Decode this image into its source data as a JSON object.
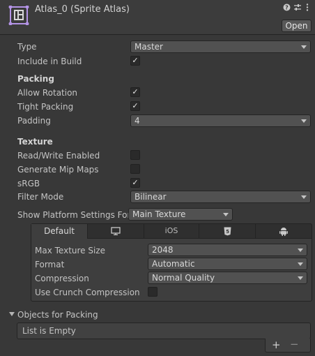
{
  "header": {
    "title": "Atlas_0 (Sprite Atlas)",
    "open_label": "Open",
    "icons": [
      "help-icon",
      "preset-sliders-icon",
      "more-menu-icon"
    ]
  },
  "properties": {
    "type": {
      "label": "Type",
      "value": "Master"
    },
    "include_in_build": {
      "label": "Include in Build",
      "checked": true
    },
    "packing_header": "Packing",
    "allow_rotation": {
      "label": "Allow Rotation",
      "checked": true
    },
    "tight_packing": {
      "label": "Tight Packing",
      "checked": true
    },
    "padding": {
      "label": "Padding",
      "value": "4"
    },
    "texture_header": "Texture",
    "read_write": {
      "label": "Read/Write Enabled",
      "checked": false
    },
    "mip_maps": {
      "label": "Generate Mip Maps",
      "checked": false
    },
    "srgb": {
      "label": "sRGB",
      "checked": true
    },
    "filter_mode": {
      "label": "Filter Mode",
      "value": "Bilinear"
    },
    "platform_settings": {
      "label": "Show Platform Settings For",
      "value": "Main Texture"
    }
  },
  "platform_tabs": {
    "tabs": [
      {
        "label": "Default",
        "icon": "none"
      },
      {
        "label": "",
        "icon": "monitor-icon"
      },
      {
        "label": "iOS",
        "icon": "none"
      },
      {
        "label": "",
        "icon": "html5-icon"
      },
      {
        "label": "",
        "icon": "android-icon"
      }
    ],
    "max_texture_size": {
      "label": "Max Texture Size",
      "value": "2048"
    },
    "format": {
      "label": "Format",
      "value": "Automatic"
    },
    "compression": {
      "label": "Compression",
      "value": "Normal Quality"
    },
    "crunch": {
      "label": "Use Crunch Compression",
      "checked": false
    }
  },
  "objects_for_packing": {
    "label": "Objects for Packing",
    "empty_text": "List is Empty",
    "add_symbol": "+",
    "remove_symbol": "−"
  },
  "colors": {
    "background": "#383838",
    "field": "#515151",
    "accent": "#a97ee0"
  }
}
